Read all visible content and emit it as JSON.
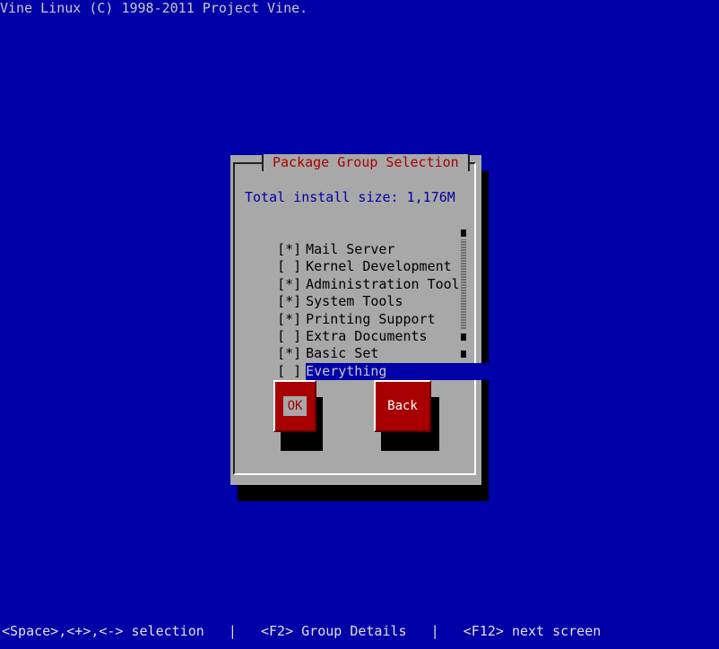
{
  "header": {
    "copyright": "Vine Linux (C) 1998-2011 Project Vine."
  },
  "dialog": {
    "title": "Package Group Selection",
    "size_label": "Total install size: 1,176M",
    "items": [
      {
        "check": "[*]",
        "label": "Mail Server",
        "checked": true
      },
      {
        "check": "[ ]",
        "label": "Kernel Development",
        "checked": false
      },
      {
        "check": "[*]",
        "label": "Administration Tools",
        "checked": true
      },
      {
        "check": "[*]",
        "label": "System Tools",
        "checked": true
      },
      {
        "check": "[*]",
        "label": "Printing Support",
        "checked": true
      },
      {
        "check": "[ ]",
        "label": "Extra Documents",
        "checked": false
      },
      {
        "check": "[*]",
        "label": "Basic Set",
        "checked": true
      },
      {
        "check": "[ ]",
        "label": "Everything",
        "checked": false
      }
    ],
    "ok_label": "OK",
    "back_label": "Back"
  },
  "footer": {
    "hint": "<Space>,<+>,<-> selection   |   <F2> Group Details   |   <F12> next screen"
  },
  "colors": {
    "background": "#0000a8",
    "dialog": "#a8a8a8",
    "title": "#a80000",
    "button": "#a80000",
    "highlight": "#0000a8"
  }
}
